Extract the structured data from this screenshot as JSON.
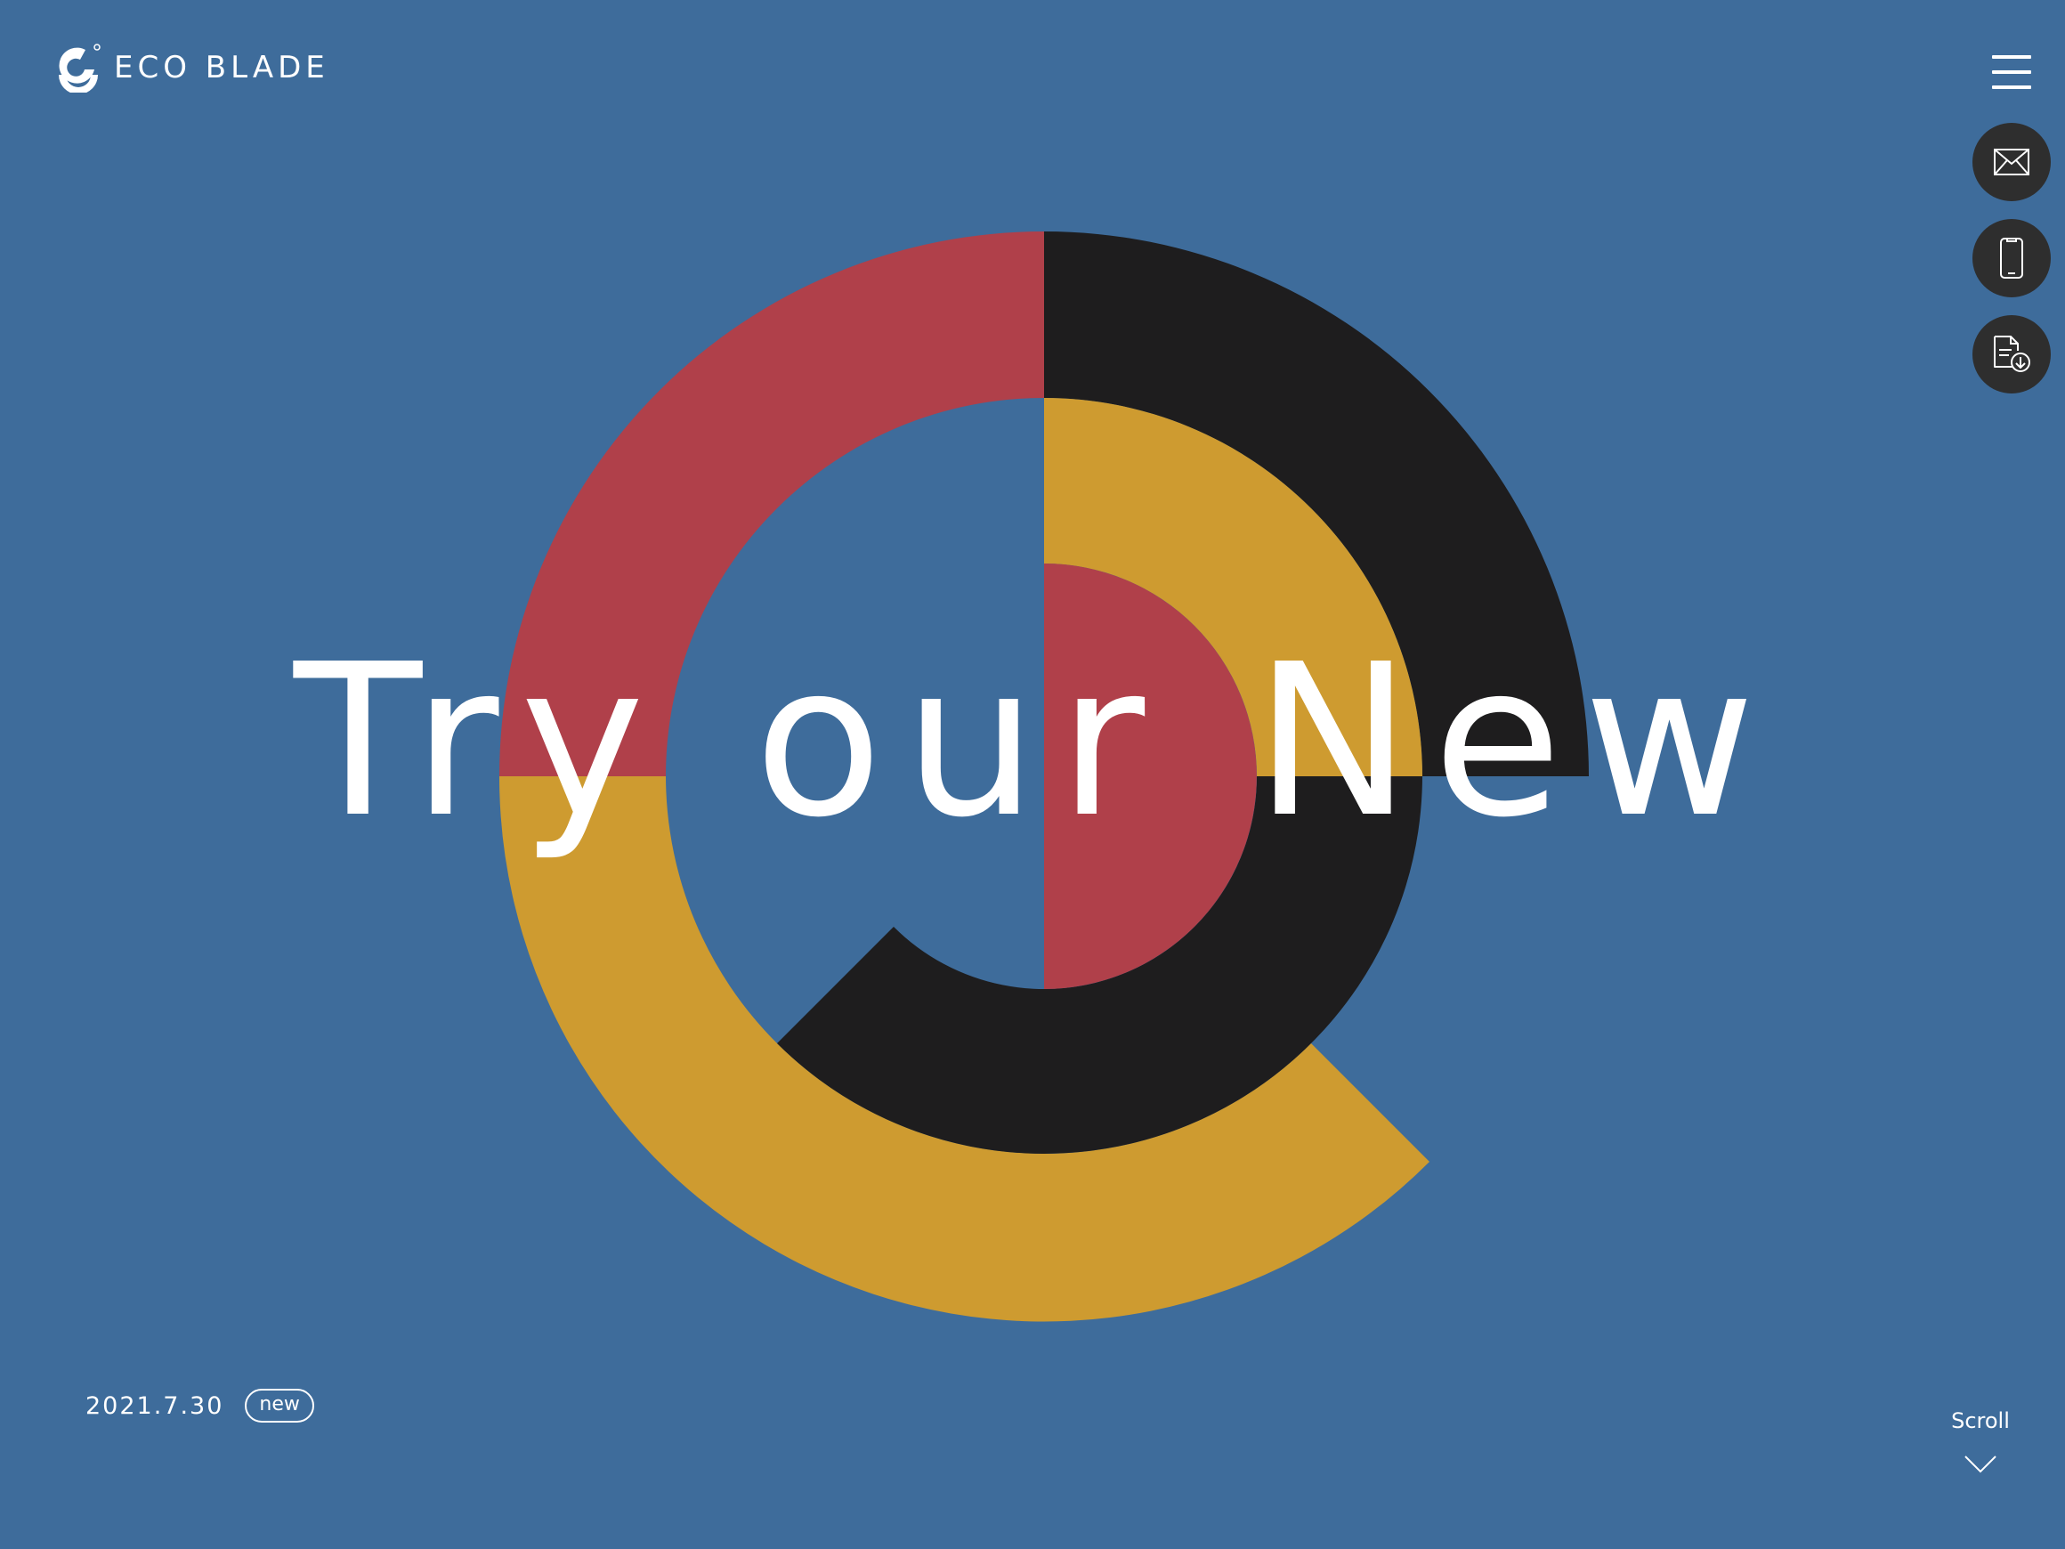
{
  "brand": {
    "name": "ECO BLADE",
    "logo_icon": "eco-blade-logo-icon"
  },
  "header": {
    "menu_icon": "hamburger-menu-icon"
  },
  "side_actions": [
    {
      "name": "mail-button",
      "icon": "mail-icon"
    },
    {
      "name": "phone-button",
      "icon": "smartphone-icon"
    },
    {
      "name": "download-button",
      "icon": "document-download-icon"
    }
  ],
  "hero": {
    "headline": "Try our New",
    "colors": {
      "background": "#3e6c9b",
      "red": "#b0404a",
      "black": "#1e1d1e",
      "yellow": "#ce9b30"
    }
  },
  "news": {
    "date": "2021.7.30",
    "tag": "new"
  },
  "scroll": {
    "label": "Scroll",
    "icon": "chevron-down-icon"
  }
}
